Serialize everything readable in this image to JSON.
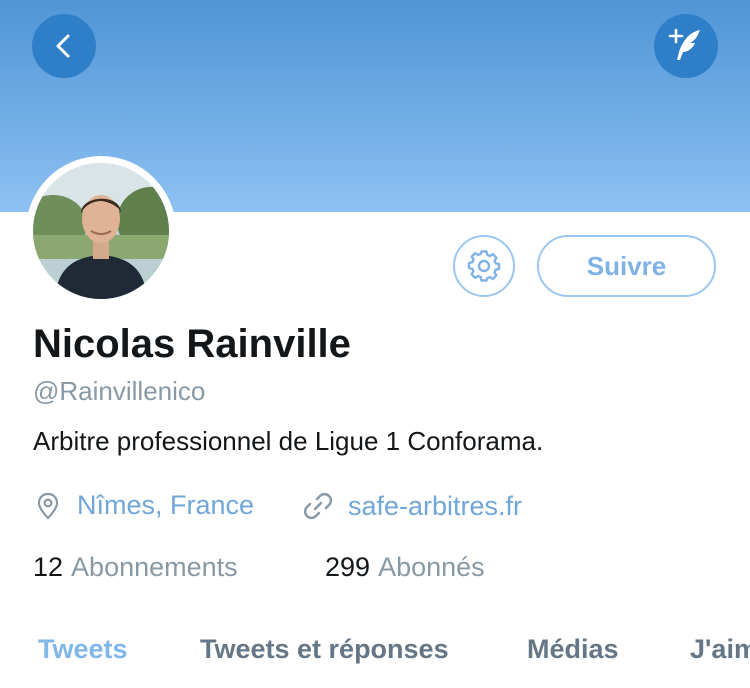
{
  "profile": {
    "name": "Nicolas Rainville",
    "handle": "@Rainvillenico",
    "bio": "Arbitre professionnel de Ligue 1 Conforama.",
    "location": "Nîmes, France",
    "website": "safe-arbitres.fr"
  },
  "actions": {
    "follow_label": "Suivre"
  },
  "stats": {
    "following_count": "12",
    "following_label": "Abonnements",
    "followers_count": "299",
    "followers_label": "Abonnés"
  },
  "tabs": [
    {
      "label": "Tweets",
      "active": true
    },
    {
      "label": "Tweets et réponses",
      "active": false
    },
    {
      "label": "Médias",
      "active": false
    },
    {
      "label": "J'aime",
      "active": false
    }
  ],
  "icons": {
    "back": "chevron-left-icon",
    "compose": "compose-tweet-icon",
    "settings": "gear-icon",
    "location": "location-pin-icon",
    "link": "link-icon"
  },
  "colors": {
    "accent": "#1da1f2",
    "banner_top": "#4f95d6",
    "banner_bottom": "#8ec1f2",
    "button_dark": "#2f7fc8",
    "link": "#71a6d9",
    "muted": "#8899a6",
    "text": "#14171a"
  }
}
